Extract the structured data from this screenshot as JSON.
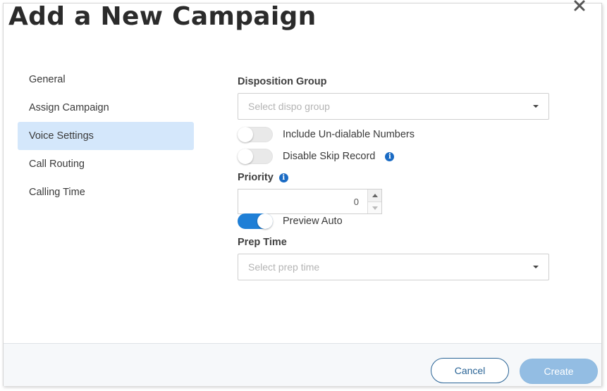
{
  "dialog": {
    "title": "Add a New Campaign",
    "close_icon": "close-icon"
  },
  "nav": {
    "items": [
      {
        "label": "General",
        "active": false
      },
      {
        "label": "Assign Campaign",
        "active": false
      },
      {
        "label": "Voice Settings",
        "active": true
      },
      {
        "label": "Call Routing",
        "active": false
      },
      {
        "label": "Calling Time",
        "active": false
      }
    ]
  },
  "form": {
    "disposition_group": {
      "label": "Disposition Group",
      "placeholder": "Select dispo group"
    },
    "include_undialable": {
      "label": "Include Un-dialable Numbers",
      "on": false
    },
    "disable_skip_record": {
      "label": "Disable Skip Record",
      "on": false,
      "info_icon": "info-icon"
    },
    "priority": {
      "label": "Priority",
      "value": "0",
      "info_icon": "info-icon"
    },
    "preview_auto": {
      "label": "Preview Auto",
      "on": true
    },
    "prep_time": {
      "label": "Prep Time",
      "placeholder": "Select prep time"
    }
  },
  "footer": {
    "cancel_label": "Cancel",
    "create_label": "Create"
  },
  "colors": {
    "accent": "#1f7fd6",
    "nav_active_bg": "#d4e7fb",
    "create_disabled": "#93bde3",
    "cancel_border": "#2a6496"
  }
}
